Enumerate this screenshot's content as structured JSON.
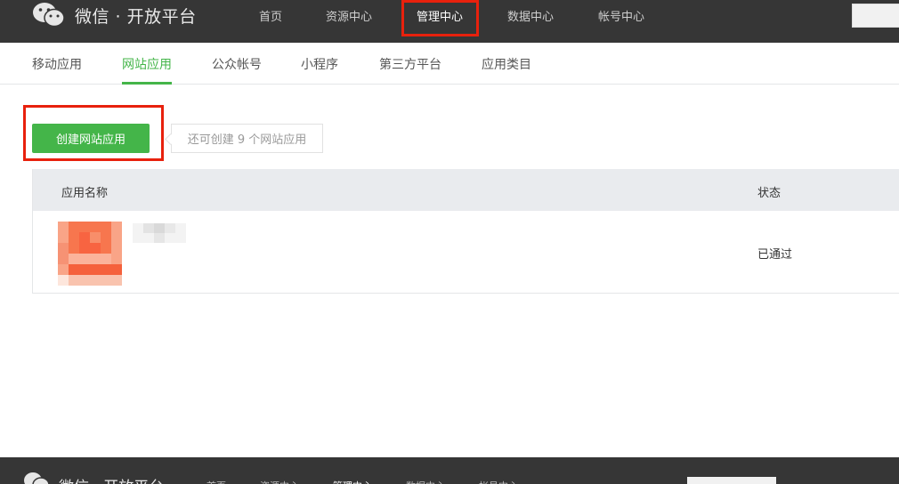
{
  "header": {
    "logo_text": "微信 · 开放平台",
    "nav": [
      {
        "label": "首页"
      },
      {
        "label": "资源中心"
      },
      {
        "label": "管理中心"
      },
      {
        "label": "数据中心"
      },
      {
        "label": "帐号中心"
      }
    ],
    "active_nav": "管理中心"
  },
  "subnav": {
    "items": [
      {
        "label": "移动应用"
      },
      {
        "label": "网站应用"
      },
      {
        "label": "公众帐号"
      },
      {
        "label": "小程序"
      },
      {
        "label": "第三方平台"
      },
      {
        "label": "应用类目"
      }
    ],
    "active": "网站应用"
  },
  "actions": {
    "create_label": "创建网站应用",
    "quota_tip": "还可创建 9 个网站应用"
  },
  "table": {
    "headers": {
      "name": "应用名称",
      "status": "状态"
    },
    "rows": [
      {
        "status": "已通过"
      }
    ]
  },
  "footer_bar": {
    "logo_text": "微信 · 开放平台"
  },
  "colors": {
    "accent": "#44b549",
    "highlight": "#e8210d",
    "topbar": "#363636"
  }
}
